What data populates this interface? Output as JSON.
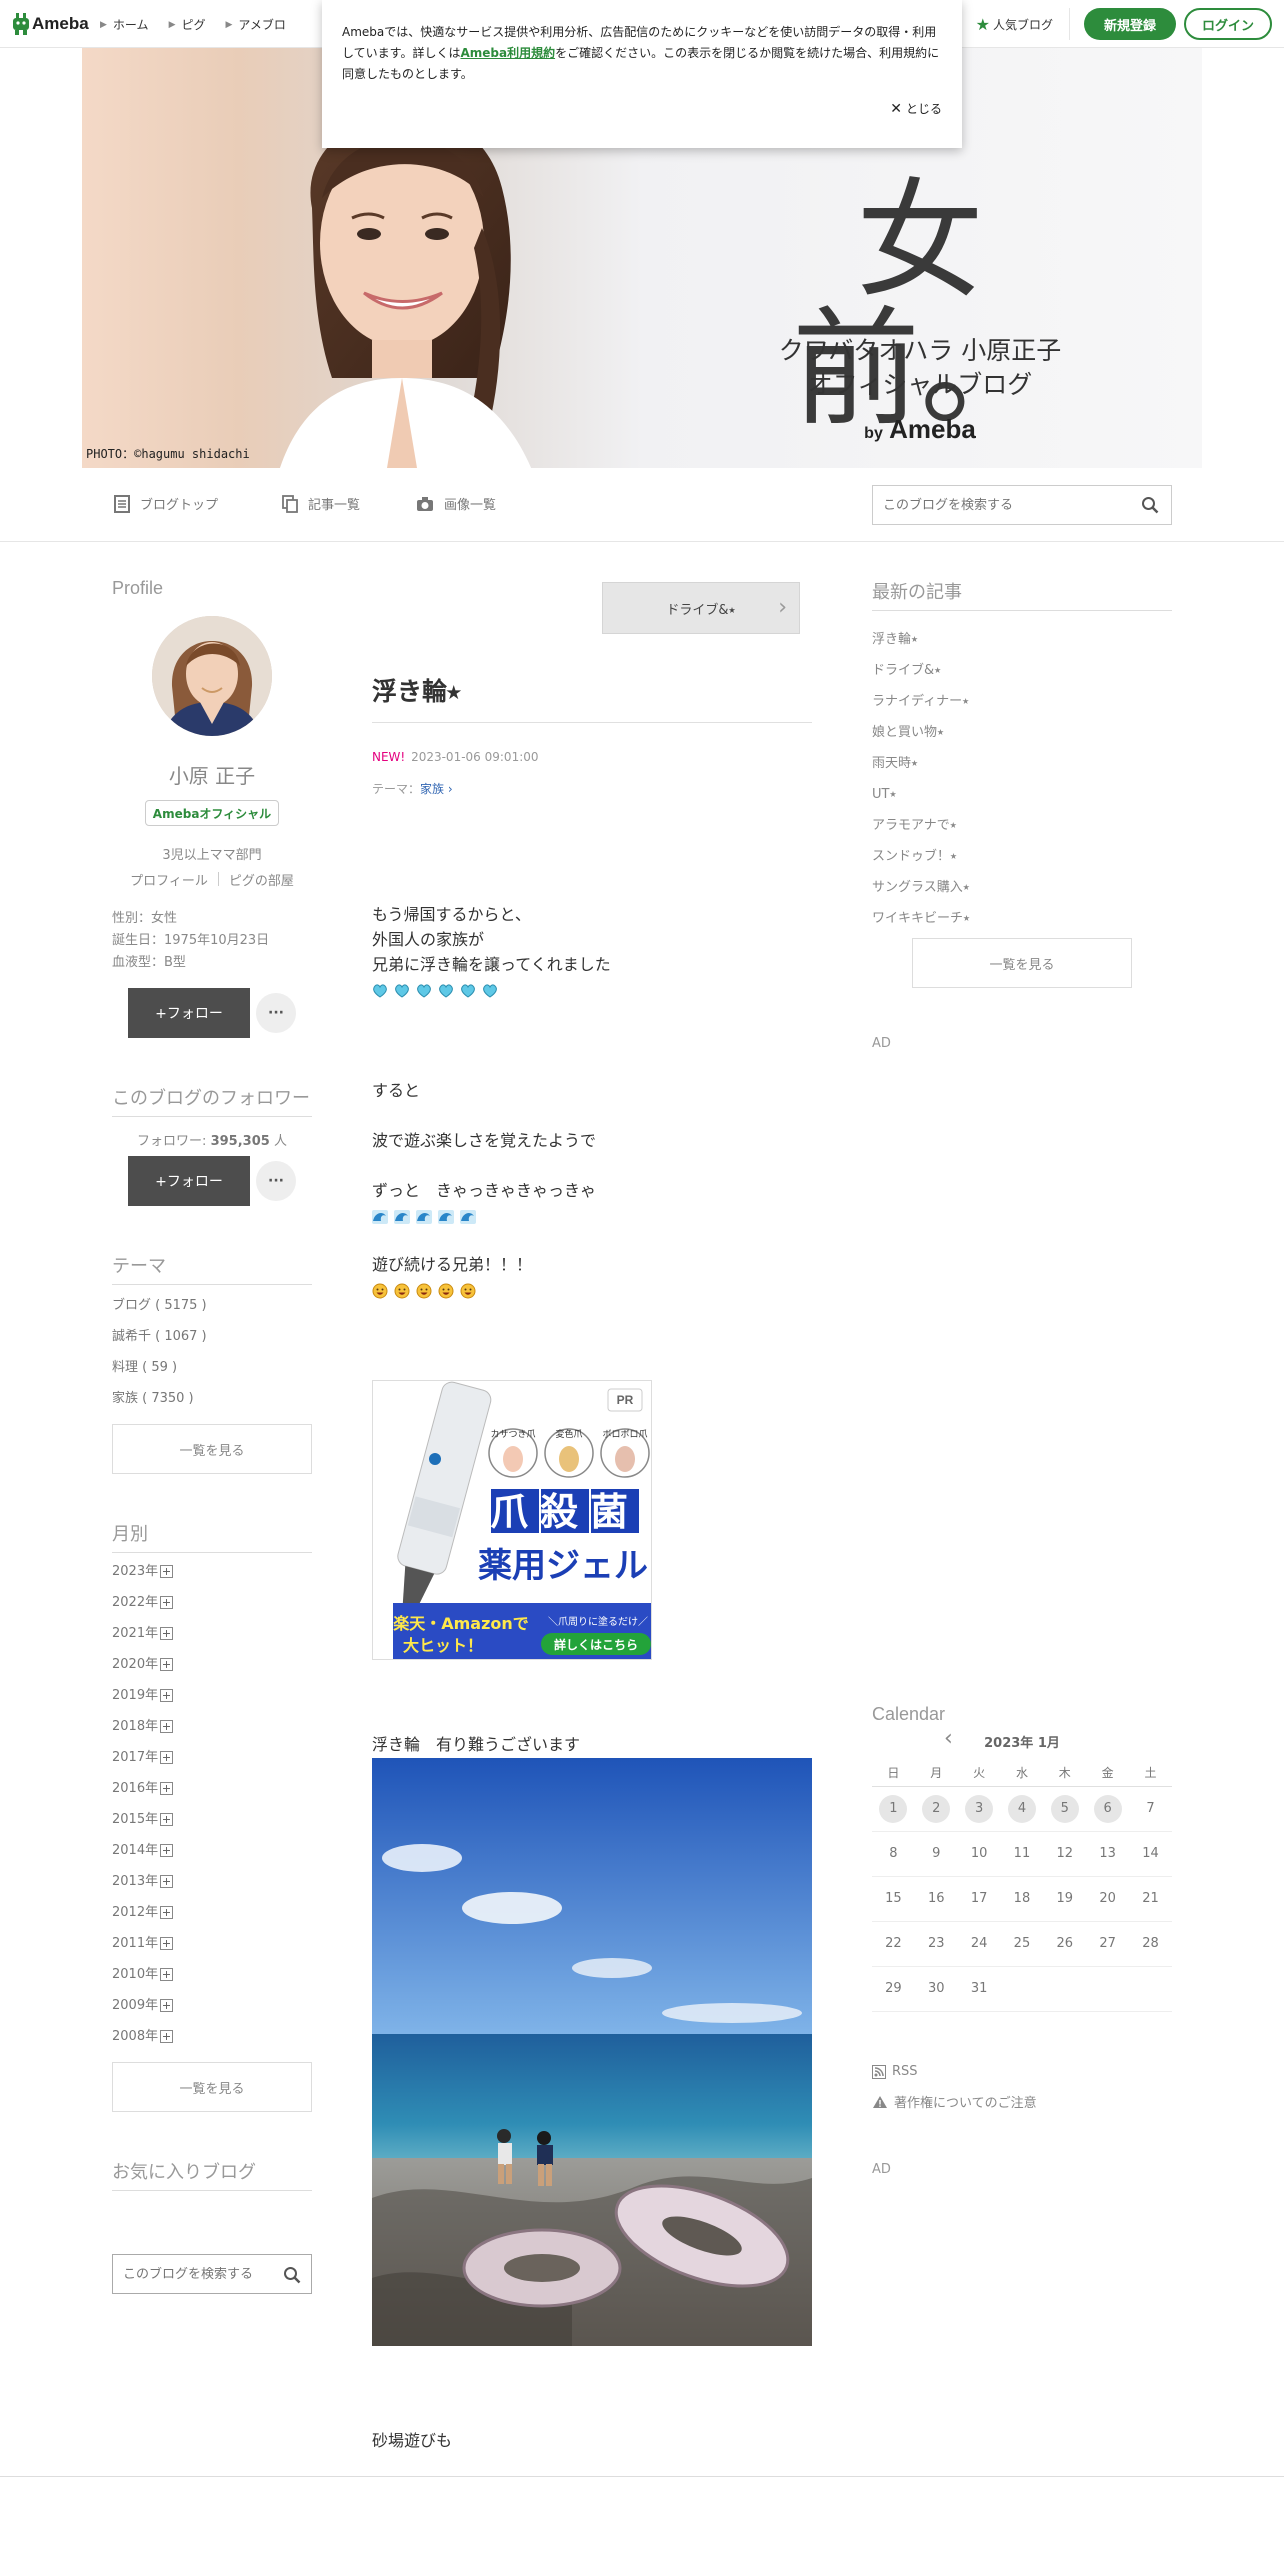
{
  "header": {
    "logo": "Ameba",
    "nav": [
      "ホーム",
      "ピグ",
      "アメブロ"
    ],
    "popular": "人気ブログ",
    "register": "新規登録",
    "login": "ログイン"
  },
  "cookie": {
    "text1": "Amebaでは、快適なサービス提供や利用分析、広告配信のためにクッキーなどを使い訪問データの取得・利用しています。詳しくは",
    "link": "Ameba利用規約",
    "text2": "をご確認ください。この表示を閉じるか閲覧を続けた場合、利用規約に同意したものとします。",
    "close": "とじる"
  },
  "banner": {
    "title": "女前。",
    "line1": "クワバタオハラ 小原正子",
    "line2": "オフィシャルブログ",
    "by": "by",
    "brand": "Ameba",
    "credit": "PHOTO：©hagumu shidachi"
  },
  "blognav": {
    "top": "ブログトップ",
    "list": "記事一覧",
    "images": "画像一覧",
    "search_placeholder": "このブログを検索する"
  },
  "profile": {
    "heading": "Profile",
    "name": "小原 正子",
    "badge": "Amebaオフィシャル",
    "desc": "3児以上ママ部門",
    "link_profile": "プロフィール",
    "link_pig": "ピグの部屋",
    "gender": "性別：女性",
    "birthday": "誕生日：1975年10月23日",
    "blood": "血液型：B型",
    "follow": "+フォロー",
    "more": "···"
  },
  "followers": {
    "heading": "このブログのフォロワー",
    "label": "フォロワー:",
    "count": "395,305",
    "unit": "人",
    "follow": "+フォロー",
    "more": "···"
  },
  "themes": {
    "heading": "テーマ",
    "items": [
      "ブログ ( 5175 )",
      "誠希千 ( 1067 )",
      "料理 ( 59 )",
      "家族 ( 7350 )"
    ],
    "more": "一覧を見る"
  },
  "monthly": {
    "heading": "月別",
    "items": [
      "2023年",
      "2022年",
      "2021年",
      "2020年",
      "2019年",
      "2018年",
      "2017年",
      "2016年",
      "2015年",
      "2014年",
      "2013年",
      "2012年",
      "2011年",
      "2010年",
      "2009年",
      "2008年"
    ],
    "more": "一覧を見る"
  },
  "favorites": {
    "heading": "お気に入りブログ",
    "search_placeholder": "このブログを検索する"
  },
  "entry": {
    "prev": "ドライブ&⭑",
    "title": "浮き輪⭑",
    "new": "NEW!",
    "date": "2023-01-06 09:01:00",
    "theme_label": "テーマ：",
    "theme": "家族",
    "p1": "もう帰国するからと、",
    "p2": "外国人の家族が",
    "p3": "兄弟に浮き輪を譲ってくれました",
    "p4": "すると",
    "p5": "波で遊ぶ楽しさを覚えたようで",
    "p6": "ずっと　きゃっきゃきゃっきゃ",
    "p7": "遊び続ける兄弟！！！",
    "p8": "浮き輪　有り難うございます",
    "p9": "砂場遊びも",
    "ad": {
      "pr": "PR",
      "label1": "カサつき爪",
      "label2": "変色爪",
      "label3": "ボロボロ爪",
      "big1": "爪殺菌",
      "big2": "薬用ジェル",
      "sub1": "楽天・Amazonで",
      "sub2": "大ヒット！",
      "sub3": "＼爪周りに塗るだけ／",
      "cta": "詳しくはこちら"
    }
  },
  "latest": {
    "heading": "最新の記事",
    "items": [
      "浮き輪⭑",
      "ドライブ&⭑",
      "ラナイディナー⭑",
      "娘と買い物⭑",
      "雨天時⭑",
      "UT⭑",
      "アラモアナで⭑",
      "スンドゥブ！⭑",
      "サングラス購入⭑",
      "ワイキキビーチ⭑"
    ],
    "more": "一覧を見る"
  },
  "ad_label": "AD",
  "calendar": {
    "heading": "Calendar",
    "month": "2023年 1月",
    "weekdays": [
      "日",
      "月",
      "火",
      "水",
      "木",
      "金",
      "土"
    ],
    "days": [
      "1",
      "2",
      "3",
      "4",
      "5",
      "6",
      "7",
      "8",
      "9",
      "10",
      "11",
      "12",
      "13",
      "14",
      "15",
      "16",
      "17",
      "18",
      "19",
      "20",
      "21",
      "22",
      "23",
      "24",
      "25",
      "26",
      "27",
      "28",
      "29",
      "30",
      "31"
    ]
  },
  "links": {
    "rss": "RSS",
    "copyright": "著作権についてのご注意"
  },
  "colors": {
    "ameba_green": "#2d8c3c",
    "new_pink": "#e4007f",
    "follow_dark": "#4d4d4d"
  }
}
